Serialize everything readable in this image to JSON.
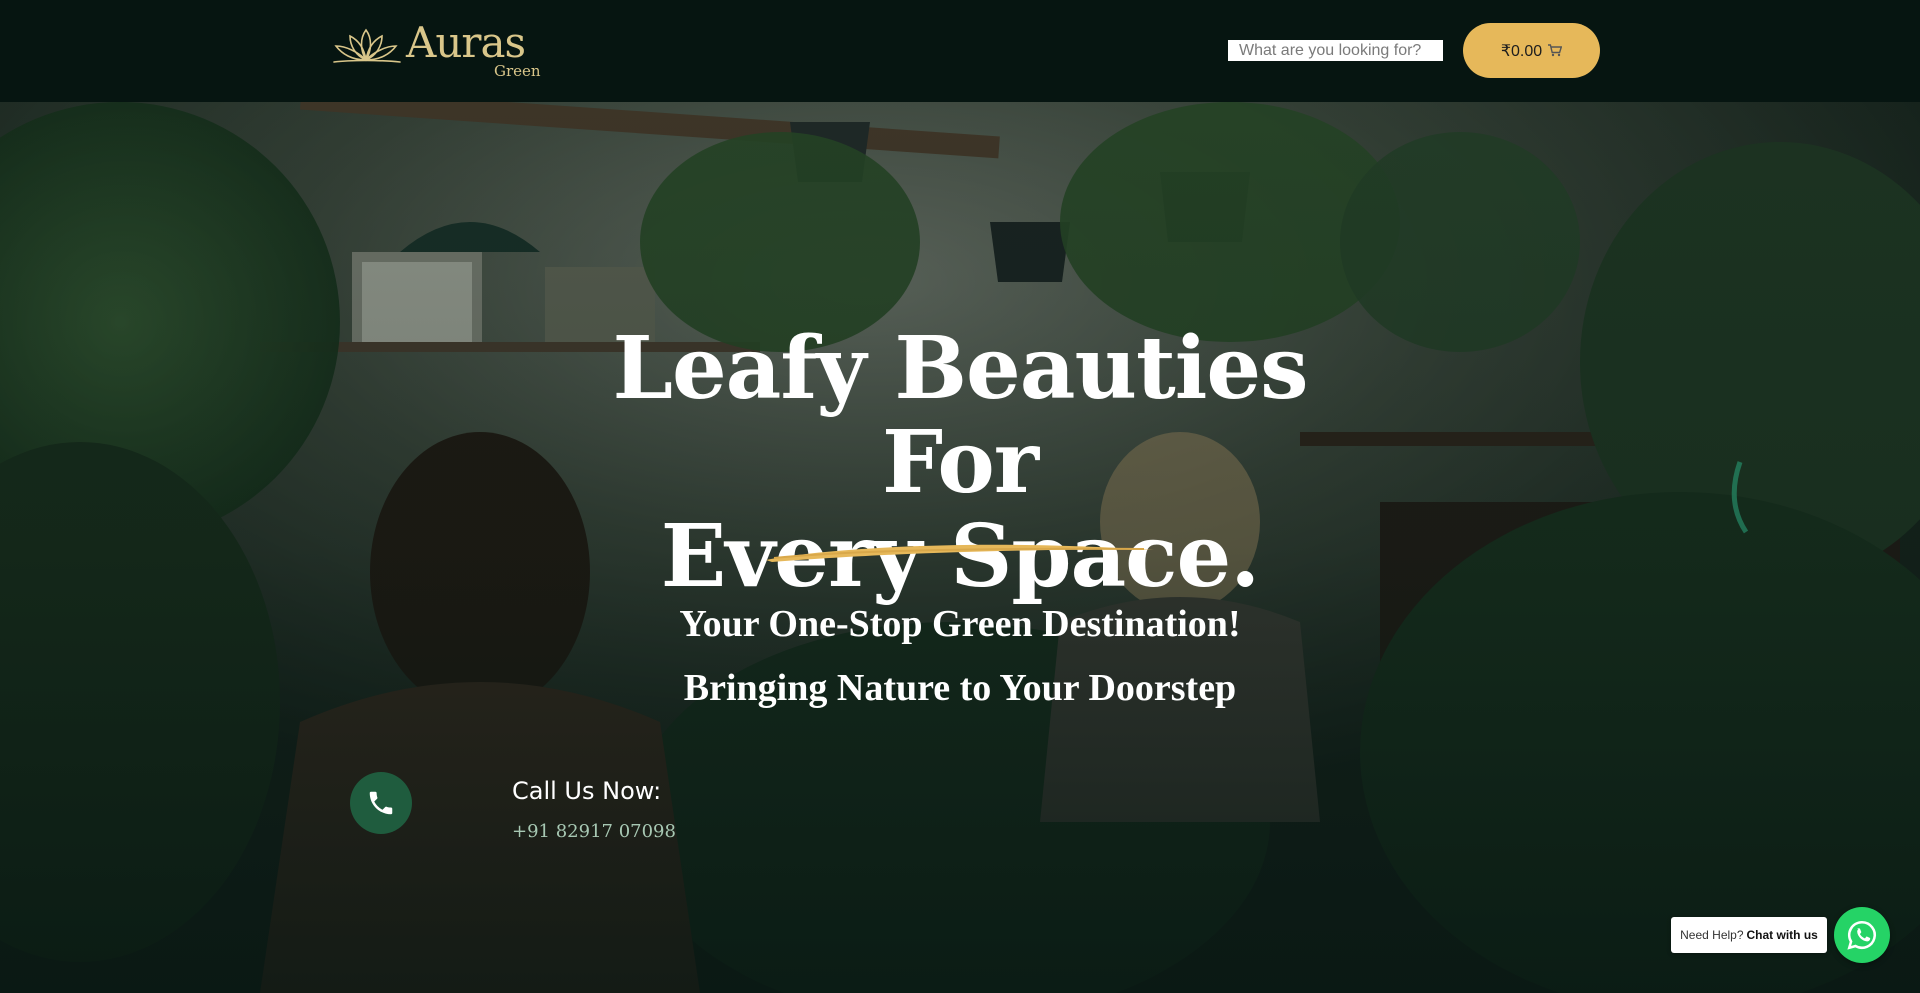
{
  "header": {
    "logo_word": "Auras",
    "logo_sub": "Green",
    "search_placeholder": "What are you looking for?",
    "cart_total": "₹0.00",
    "cart_icon": "cart-icon"
  },
  "hero": {
    "title_line1": "Leafy Beauties For",
    "title_line2": "Every Space.",
    "tagline1": "Your One-Stop Green Destination!",
    "tagline2": "Bringing Nature to Your Doorstep",
    "call_label": "Call Us Now:",
    "call_number": "+91 82917 07098",
    "phone_icon": "phone-icon"
  },
  "chat": {
    "help_text": "Need Help?",
    "help_bold": "Chat with us",
    "whatsapp_icon": "whatsapp-icon"
  },
  "colors": {
    "header_bg": "#061511",
    "accent_gold": "#e6b85a",
    "logo_gold": "#d9c68a",
    "phone_green": "#1f5c3e",
    "whatsapp_green": "#25d366"
  }
}
